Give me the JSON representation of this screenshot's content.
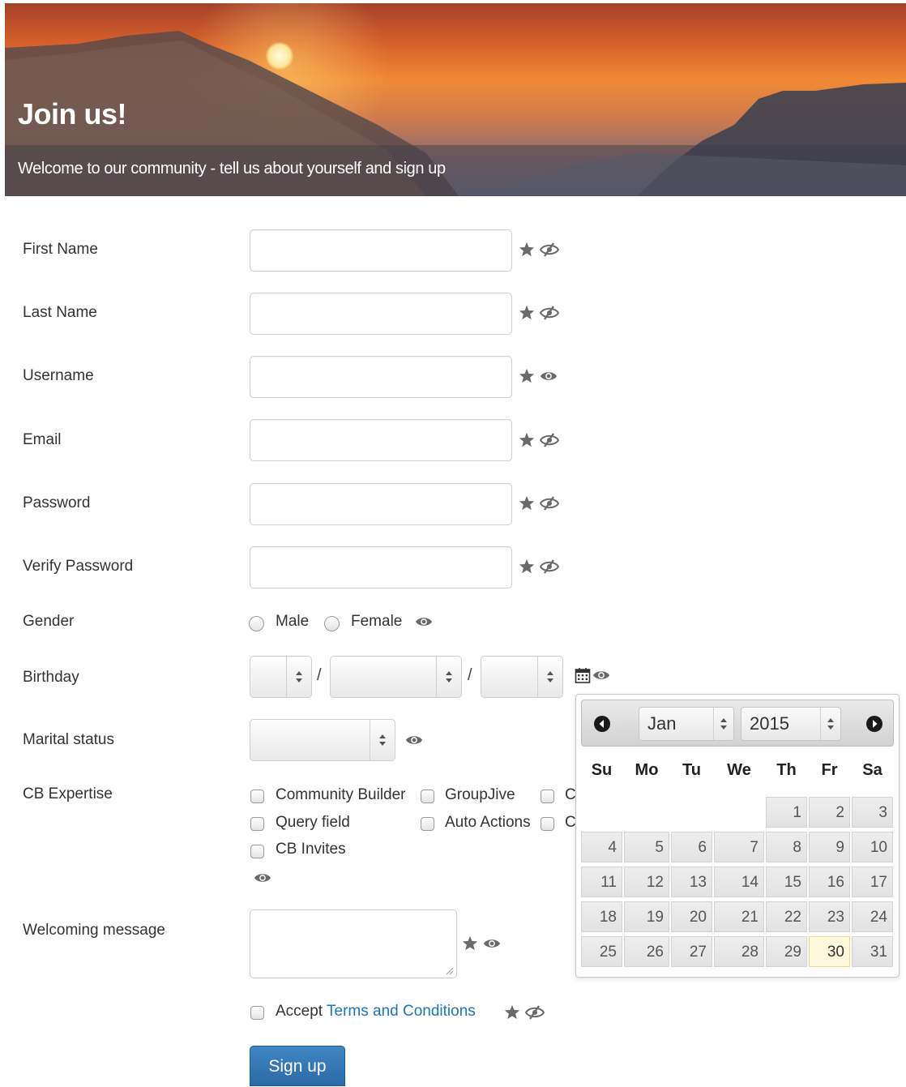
{
  "header": {
    "title": "Join us!",
    "subtitle": "Welcome to our community - tell us about yourself and sign up"
  },
  "fields": [
    {
      "label": "First Name",
      "required": true,
      "visibility": "hidden"
    },
    {
      "label": "Last Name",
      "required": true,
      "visibility": "hidden"
    },
    {
      "label": "Username",
      "required": true,
      "visibility": "visible"
    },
    {
      "label": "Email",
      "required": true,
      "visibility": "hidden"
    },
    {
      "label": "Password",
      "required": true,
      "visibility": "hidden"
    },
    {
      "label": "Verify Password",
      "required": true,
      "visibility": "hidden"
    }
  ],
  "gender": {
    "label": "Gender",
    "options": [
      "Male",
      "Female"
    ],
    "visibility": "visible"
  },
  "birthday": {
    "label": "Birthday",
    "separator": "/",
    "icon": "calendar-icon",
    "visibility": "visible"
  },
  "marital_status": {
    "label": "Marital status",
    "visibility": "visible"
  },
  "cb_expertise": {
    "label": "CB Expertise",
    "options": [
      "Community Builder",
      "GroupJive",
      "C",
      "Query field",
      "Auto Actions",
      "C",
      "CB Invites"
    ],
    "visibility": "visible"
  },
  "welcoming_message": {
    "label": "Welcoming message",
    "required": true,
    "visibility": "visible"
  },
  "terms": {
    "prefix": "Accept",
    "link_text": "Terms and Conditions",
    "required": true,
    "visibility": "hidden"
  },
  "signup_button": "Sign up",
  "datepicker": {
    "month": "Jan",
    "year": "2015",
    "weekdays": [
      "Su",
      "Mo",
      "Tu",
      "We",
      "Th",
      "Fr",
      "Sa"
    ],
    "weeks": [
      [
        "",
        "",
        "",
        "",
        "1",
        "2",
        "3"
      ],
      [
        "4",
        "5",
        "6",
        "7",
        "8",
        "9",
        "10"
      ],
      [
        "11",
        "12",
        "13",
        "14",
        "15",
        "16",
        "17"
      ],
      [
        "18",
        "19",
        "20",
        "21",
        "22",
        "23",
        "24"
      ],
      [
        "25",
        "26",
        "27",
        "28",
        "29",
        "30",
        "31"
      ]
    ],
    "today": "30"
  },
  "colors": {
    "primary_button": "#2a6aa6",
    "link": "#1b75bb",
    "icon": "#6a6a6a"
  }
}
